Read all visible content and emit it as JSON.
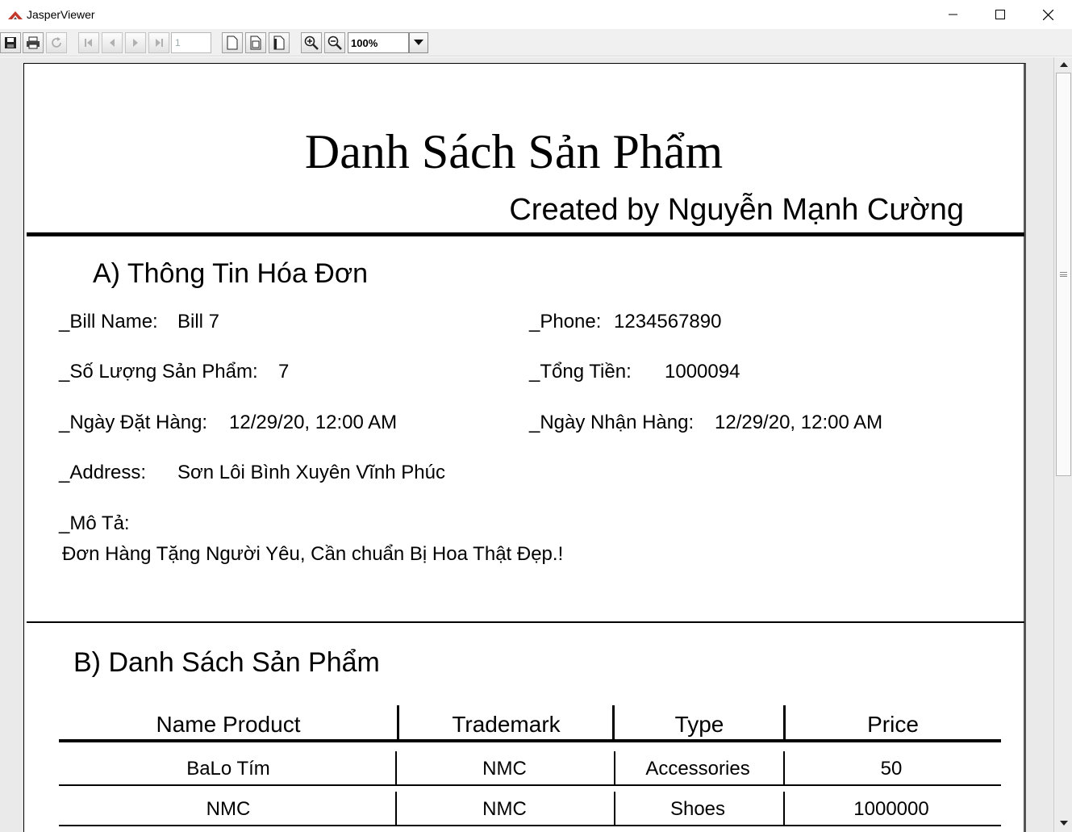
{
  "window": {
    "title": "JasperViewer"
  },
  "toolbar": {
    "page_number": "1",
    "zoom": "100%"
  },
  "report": {
    "title": "Danh Sách Sản Phẩm",
    "created_by": "Created by Nguyễn Mạnh Cường",
    "section_a": {
      "title": "A) Thông Tin Hóa Đơn",
      "bill_name_label": "_Bill Name:",
      "bill_name_value": "Bill 7",
      "phone_label": "_Phone:",
      "phone_value": "1234567890",
      "quantity_label": "_Số Lượng Sản Phẩm:",
      "quantity_value": "7",
      "total_label": "_Tổng Tiền:",
      "total_value": "1000094",
      "order_date_label": "_Ngày Đặt Hàng:",
      "order_date_value": "12/29/20, 12:00 AM",
      "receive_date_label": "_Ngày Nhận Hàng:",
      "receive_date_value": "12/29/20, 12:00 AM",
      "address_label": "_Address:",
      "address_value": "Sơn Lôi Bình Xuyên Vĩnh Phúc",
      "description_label": "_Mô Tả:",
      "description_value": "Đơn Hàng Tặng Người Yêu, Cần chuẩn Bị Hoa Thật Đẹp.!"
    },
    "section_b": {
      "title": "B) Danh Sách Sản Phẩm",
      "columns": [
        "Name Product",
        "Trademark",
        "Type",
        "Price"
      ],
      "rows": [
        [
          "BaLo Tím",
          "NMC",
          "Accessories",
          "50"
        ],
        [
          "NMC",
          "NMC",
          "Shoes",
          "1000000"
        ]
      ]
    }
  }
}
